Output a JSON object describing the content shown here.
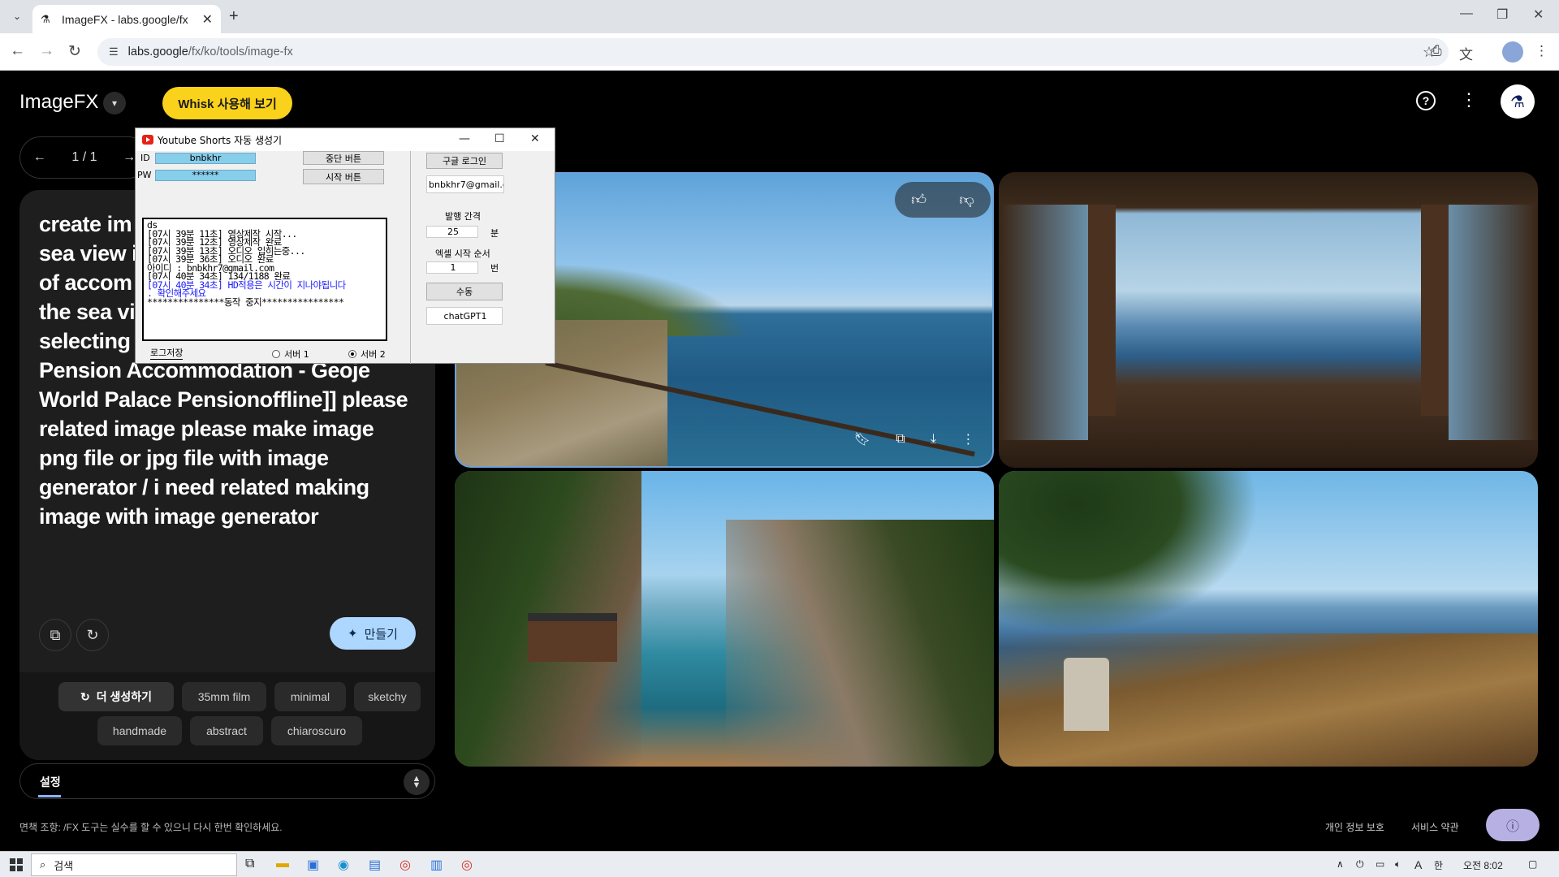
{
  "browser": {
    "tab_title": "ImageFX - labs.google/fx",
    "url_host": "labs.google",
    "url_path": "/fx/ko/tools/image-fx"
  },
  "app": {
    "logo": "ImageFX",
    "whisk_label": "Whisk 사용해 보기",
    "pager": "1 / 1",
    "prompt": "create image with this topic: Geoje sea view pension... [[a pension with a sea view is a type of accommodation that provides the sea view... selecting Geoje Sea View Pension Accommodation - Geoje World Palace Pensionoffline]] please related image please make image png file or jpg file with image generator / i need related making image with image generator",
    "prompt_visible": "create im\nsea view i\nof accom\nthe sea vi\nselecting\nPension Accommodation - Geoje\nWorld Palace Pensionoffline]]  please\nrelated image please make image\npng file or jpg file with image\ngenerator / i need related making\nimage with image generator",
    "make_label": "만들기",
    "regen_label": "더 생성하기",
    "chips": [
      "35mm film",
      "minimal",
      "sketchy",
      "handmade",
      "abstract",
      "chiaroscuro"
    ],
    "settings_label": "설정",
    "disclaimer": "면책 조항: /FX 도구는 실수를 할 수 있으니 다시 한번 확인하세요.",
    "privacy": "개인 정보 보호",
    "terms": "서비스 약관"
  },
  "overlay": {
    "title": "Youtube Shorts 자동 생성기",
    "id_label": "ID",
    "id_value": "bnbkhr",
    "pw_label": "PW",
    "pw_value": "******",
    "stop_btn": "중단 버튼",
    "start_btn": "시작 버튼",
    "google_login": "구글 로그인",
    "email": "bnbkhr7@gmail.c",
    "interval_label": "발행 간격",
    "interval_value": "25",
    "interval_unit": "분",
    "excel_label": "엑셀 시작 순서",
    "excel_value": "1",
    "excel_unit": "번",
    "manual_btn": "수동",
    "chatgpt_btn": "chatGPT1",
    "log_save": "로그저장",
    "server1": "서버 1",
    "server2": "서버 2",
    "log": [
      {
        "text": "ds",
        "color": "black"
      },
      {
        "text": "[07시 39분 11초] 영상제작 시작...",
        "color": "black"
      },
      {
        "text": "[07시 39분 12초] 영상제작 완료",
        "color": "black"
      },
      {
        "text": "[07시 39분 13초] 오디오 입히는중...",
        "color": "black"
      },
      {
        "text": "[07시 39분 36초] 오디오 완료",
        "color": "black"
      },
      {
        "text": "아이디 : bnbkhr7@gmail.com",
        "color": "black"
      },
      {
        "text": "[07시 40분 34초] 134/1188 완료",
        "color": "black"
      },
      {
        "text": "[07시 40분 34초] HD적용은 시간이 지나야됩니다",
        "color": "blue"
      },
      {
        "text": ". 확인해주세요",
        "color": "blue"
      },
      {
        "text": "***************동작 중지****************",
        "color": "black"
      }
    ]
  },
  "taskbar": {
    "search_placeholder": "검색",
    "time": "오전 8:02",
    "ime": "A"
  }
}
